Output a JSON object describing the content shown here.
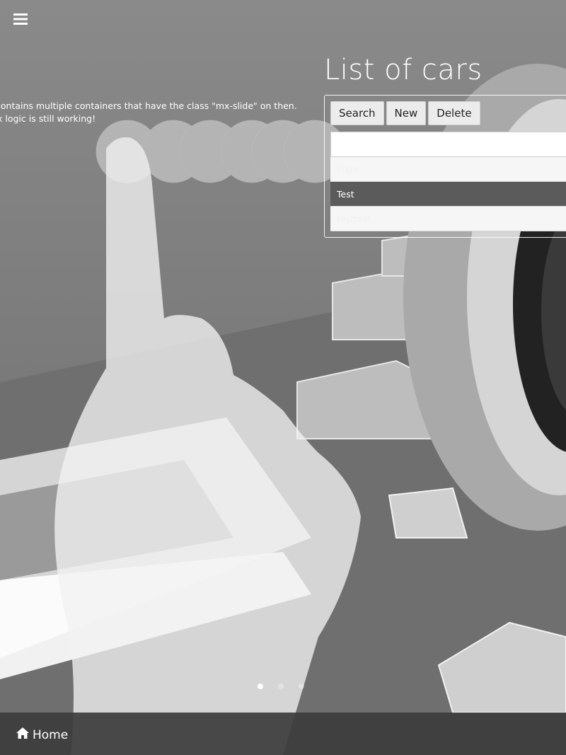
{
  "header": {
    "menu_icon": "hamburger-menu-icon"
  },
  "intro": {
    "line1": "contains multiple containers that have the class \"mx-slide\" on then.",
    "line2": "x logic is still working!"
  },
  "main": {
    "title": "List of cars",
    "toolbar": {
      "search_label": "Search",
      "new_label": "New",
      "delete_label": "Delete"
    },
    "search": {
      "value": "",
      "placeholder": ""
    },
    "list": {
      "items": [
        {
          "label": "Plant",
          "selected": false
        },
        {
          "label": "Test",
          "selected": true
        },
        {
          "label": "testtest",
          "selected": false
        }
      ]
    }
  },
  "carousel": {
    "slide_count": 3,
    "active_index": 0
  },
  "footer": {
    "home_label": "Home",
    "home_icon": "home-icon"
  },
  "colors": {
    "background": "#8e8e8e",
    "list_selected": "#5b5b5b",
    "bottom_bar": "#3c3c3c"
  }
}
